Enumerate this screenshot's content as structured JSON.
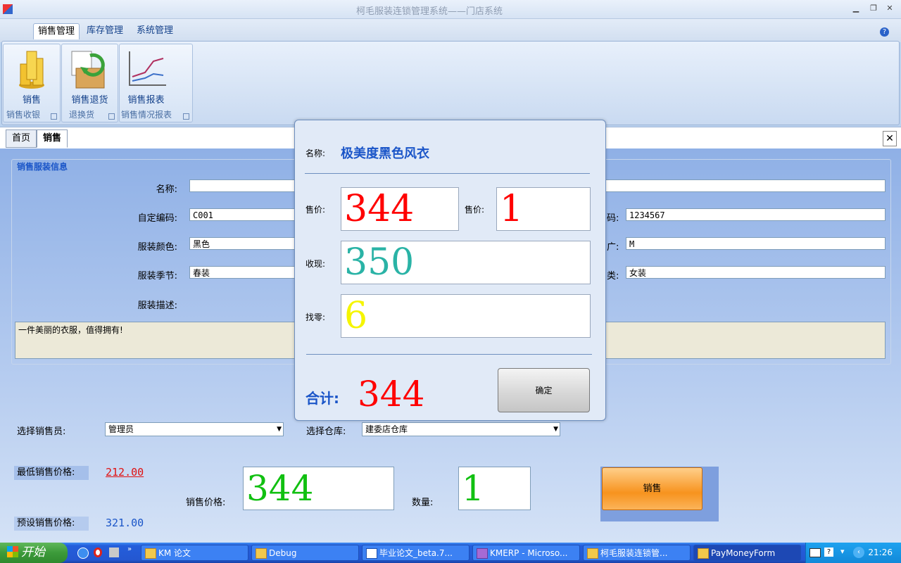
{
  "window": {
    "title": "柯毛服装连锁管理系统——门店系统"
  },
  "menu": {
    "tabs": [
      "销售管理",
      "库存管理",
      "系统管理"
    ]
  },
  "ribbon": {
    "groups": [
      {
        "button": "销售",
        "caption": "销售收银"
      },
      {
        "button": "销售退货",
        "caption": "退换货"
      },
      {
        "button": "销售报表",
        "caption": "销售情况报表"
      }
    ]
  },
  "doc_tabs": [
    "首页",
    "销售"
  ],
  "form": {
    "group_title": "销售服装信息",
    "name_label": "名称:",
    "name_value": "",
    "code_label": "自定编码:",
    "code_value": "C001",
    "barcode_label_fragment": "码:",
    "barcode_value": "1234567",
    "color_label": "服装颜色:",
    "color_value": "黑色",
    "size_label_fragment": "广:",
    "size_value": "M",
    "season_label": "服装季节:",
    "season_value": "春装",
    "type_label_fragment": "类:",
    "type_value": "女装",
    "desc_label": "服装描述:",
    "desc_value": "一件美丽的衣服，值得拥有!"
  },
  "sales": {
    "seller_label": "选择销售员:",
    "seller_value": "管理员",
    "warehouse_label": "选择仓库:",
    "warehouse_value": "建委店仓库",
    "min_price_label": "最低销售价格:",
    "min_price_value": "212.00",
    "preset_price_label": "预设销售价格:",
    "preset_price_value": "321.00",
    "price_label": "销售价格:",
    "price_value": "344",
    "qty_label": "数量:",
    "qty_value": "1",
    "sell_button": "销售"
  },
  "dialog": {
    "name_label": "名称:",
    "name_value": "极美度黑色风衣",
    "price_label": "售价:",
    "price_value": "344",
    "qty_label": "售价:",
    "qty_value": "1",
    "received_label": "收现:",
    "received_value": "350",
    "change_label": "找零:",
    "change_value": "6",
    "total_label": "合计:",
    "total_value": "344",
    "ok_button": "确定"
  },
  "taskbar": {
    "start": "开始",
    "tasks": [
      "KM 论文",
      "Debug",
      "毕业论文_beta.7...",
      "KMERP - Microso...",
      "柯毛服装连锁管...",
      "PayMoneyForm"
    ],
    "clock": "21:26"
  },
  "colors": {
    "dialog_price": "#ff0000",
    "dialog_received": "#2ab3a6",
    "dialog_change": "#ffff00",
    "sale_price": "#11c011",
    "title_blue": "#1a55c8",
    "min_price": "#e01010"
  }
}
